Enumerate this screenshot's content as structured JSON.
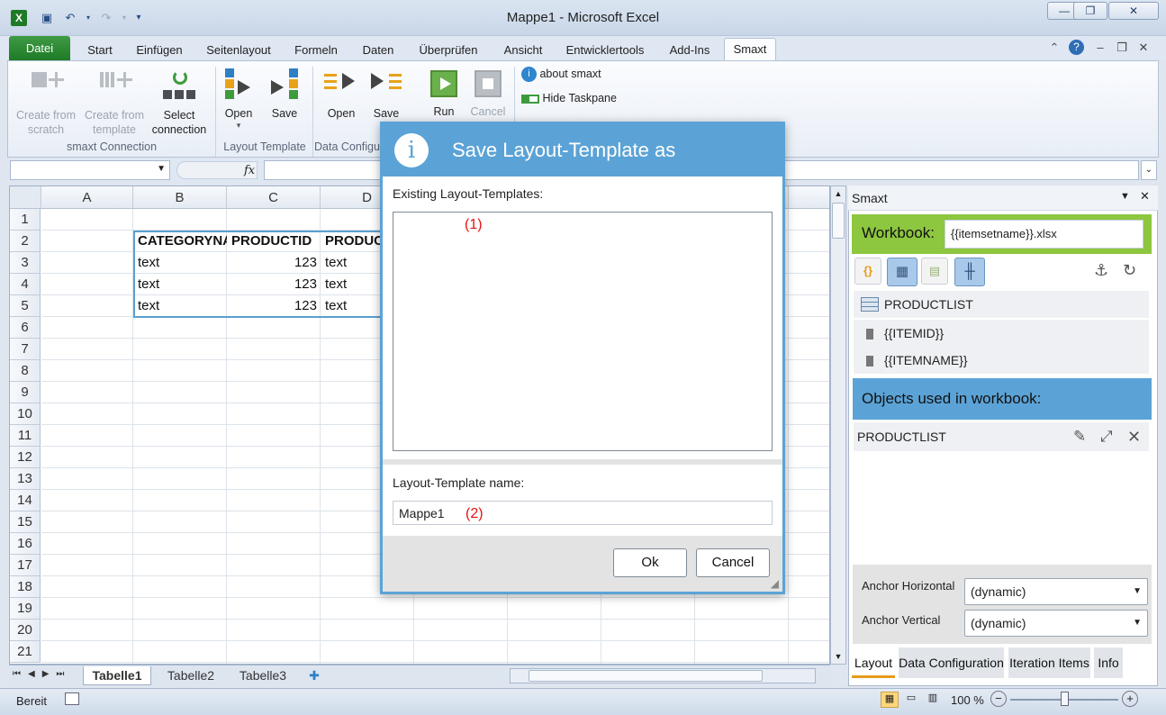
{
  "window": {
    "title": "Mappe1  -  Microsoft Excel"
  },
  "ribbon": {
    "tabs": [
      "Datei",
      "Start",
      "Einfügen",
      "Seitenlayout",
      "Formeln",
      "Daten",
      "Überprüfen",
      "Ansicht",
      "Entwicklertools",
      "Add-Ins",
      "Smaxt"
    ],
    "active_tab": "Smaxt",
    "create_scratch": "Create from\nscratch",
    "create_template": "Create from\ntemplate",
    "select_connection": "Select\nconnection",
    "group_connection": "smaxt Connection",
    "layout_open": "Open",
    "layout_save": "Save",
    "group_layout": "Layout Template",
    "data_open": "Open",
    "data_save": "Save",
    "group_data": "Data Configu",
    "run": "Run",
    "cancel": "Cancel",
    "about": "about smaxt",
    "hide_taskpane": "Hide Taskpane"
  },
  "formula": {
    "fx": "fx",
    "name_value": "",
    "formula_value": ""
  },
  "sheet": {
    "columns": [
      "A",
      "B",
      "C",
      "D"
    ],
    "rows": [
      "1",
      "2",
      "3",
      "4",
      "5",
      "6",
      "7",
      "8",
      "9",
      "10",
      "11",
      "12",
      "13",
      "14",
      "15",
      "16",
      "17",
      "18",
      "19",
      "20",
      "21"
    ],
    "cells": {
      "b2": "CATEGORYNA",
      "c2": "PRODUCTID",
      "d2": "PRODUC",
      "b3": "text",
      "c3": "123",
      "d3": "text",
      "b4": "text",
      "c4": "123",
      "d4": "text",
      "b5": "text",
      "c5": "123",
      "d5": "text"
    },
    "tabs": [
      "Tabelle1",
      "Tabelle2",
      "Tabelle3"
    ],
    "active_tab": "Tabelle1"
  },
  "status": {
    "ready": "Bereit",
    "zoom": "100 %"
  },
  "pane": {
    "title": "Smaxt",
    "workbook_label": "Workbook:",
    "workbook_value": "{{itemsetname}}.xlsx",
    "tree": {
      "list": "PRODUCTLIST",
      "item1": "{{ITEMID}}",
      "item2": "{{ITEMNAME}}"
    },
    "objects_header": "Objects used in workbook:",
    "object_row": "PRODUCTLIST",
    "anchor_h_label": "Anchor Horizontal",
    "anchor_h_value": "(dynamic)",
    "anchor_v_label": "Anchor Vertical",
    "anchor_v_value": "(dynamic)",
    "tabs": [
      "Layout",
      "Data Configuration",
      "Iteration Items",
      "Info"
    ],
    "active_tab": "Layout"
  },
  "dialog": {
    "title": "Save Layout-Template as",
    "existing_label": "Existing Layout-Templates:",
    "marker1": "(1)",
    "name_label": "Layout-Template name:",
    "name_value": "Mappe1",
    "marker2": "(2)",
    "ok": "Ok",
    "cancel": "Cancel"
  },
  "colors": {
    "ribbon_file_green": "#1e7a26",
    "pane_green": "#8dc63f",
    "dialog_blue": "#5ba3d6",
    "marker_red": "#e8110f"
  }
}
